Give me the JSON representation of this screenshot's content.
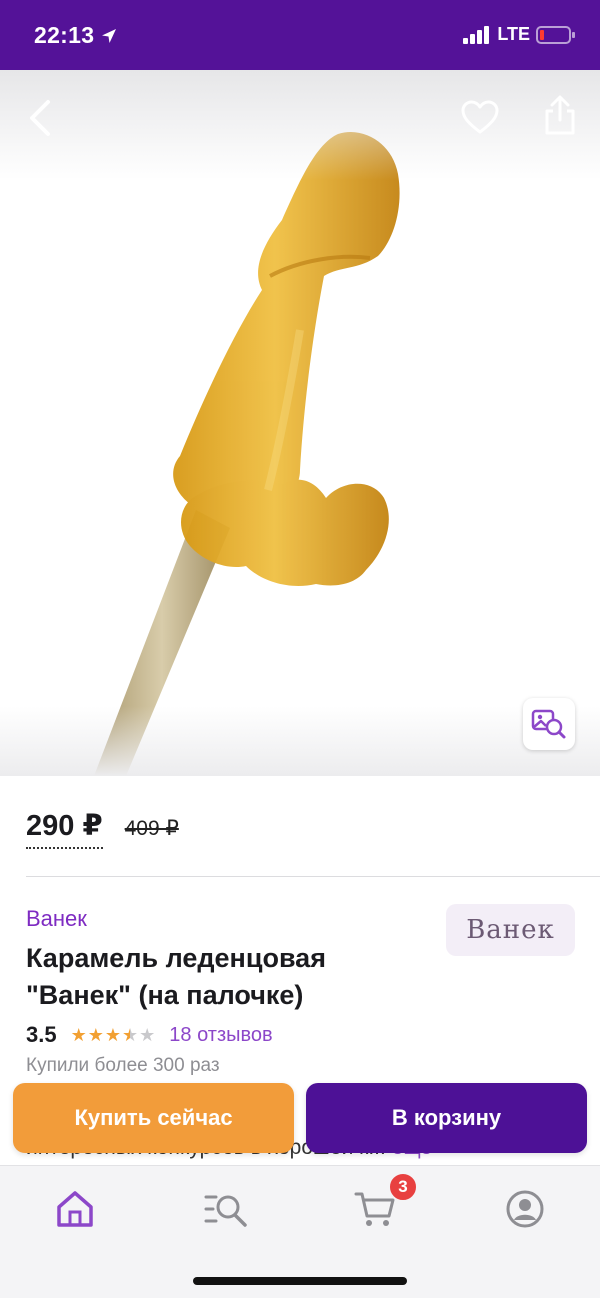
{
  "status_bar": {
    "time": "22:13",
    "network": "LTE",
    "background": "#541298",
    "battery_level": 0.1
  },
  "product": {
    "image_desc": "amber caramel lollipop on a wooden stick",
    "price_current": "290 ₽",
    "price_old": "409 ₽",
    "brand": "Ванек",
    "brand_logo_text": "Ванек",
    "title": "Карамель леденцовая \"Ванек\" (на палочке)",
    "rating": "3.5",
    "rating_stars": 3.5,
    "reviews": "18 отзывов",
    "purchases": "Купили более 300 раз",
    "description_fragment": "интересных конкурсов в хорошей к...",
    "description_hidden_start": "к",
    "more_label": "еще"
  },
  "actions": {
    "buy_now": "Купить сейчас",
    "add_to_cart": "В корзину",
    "buy_now_color": "#f29c3a",
    "add_to_cart_color": "#4d1196"
  },
  "tab_bar": {
    "items": [
      "home",
      "catalog-search",
      "cart",
      "profile"
    ],
    "active": "home",
    "cart_count": "3",
    "accent": "#8c47c9"
  }
}
